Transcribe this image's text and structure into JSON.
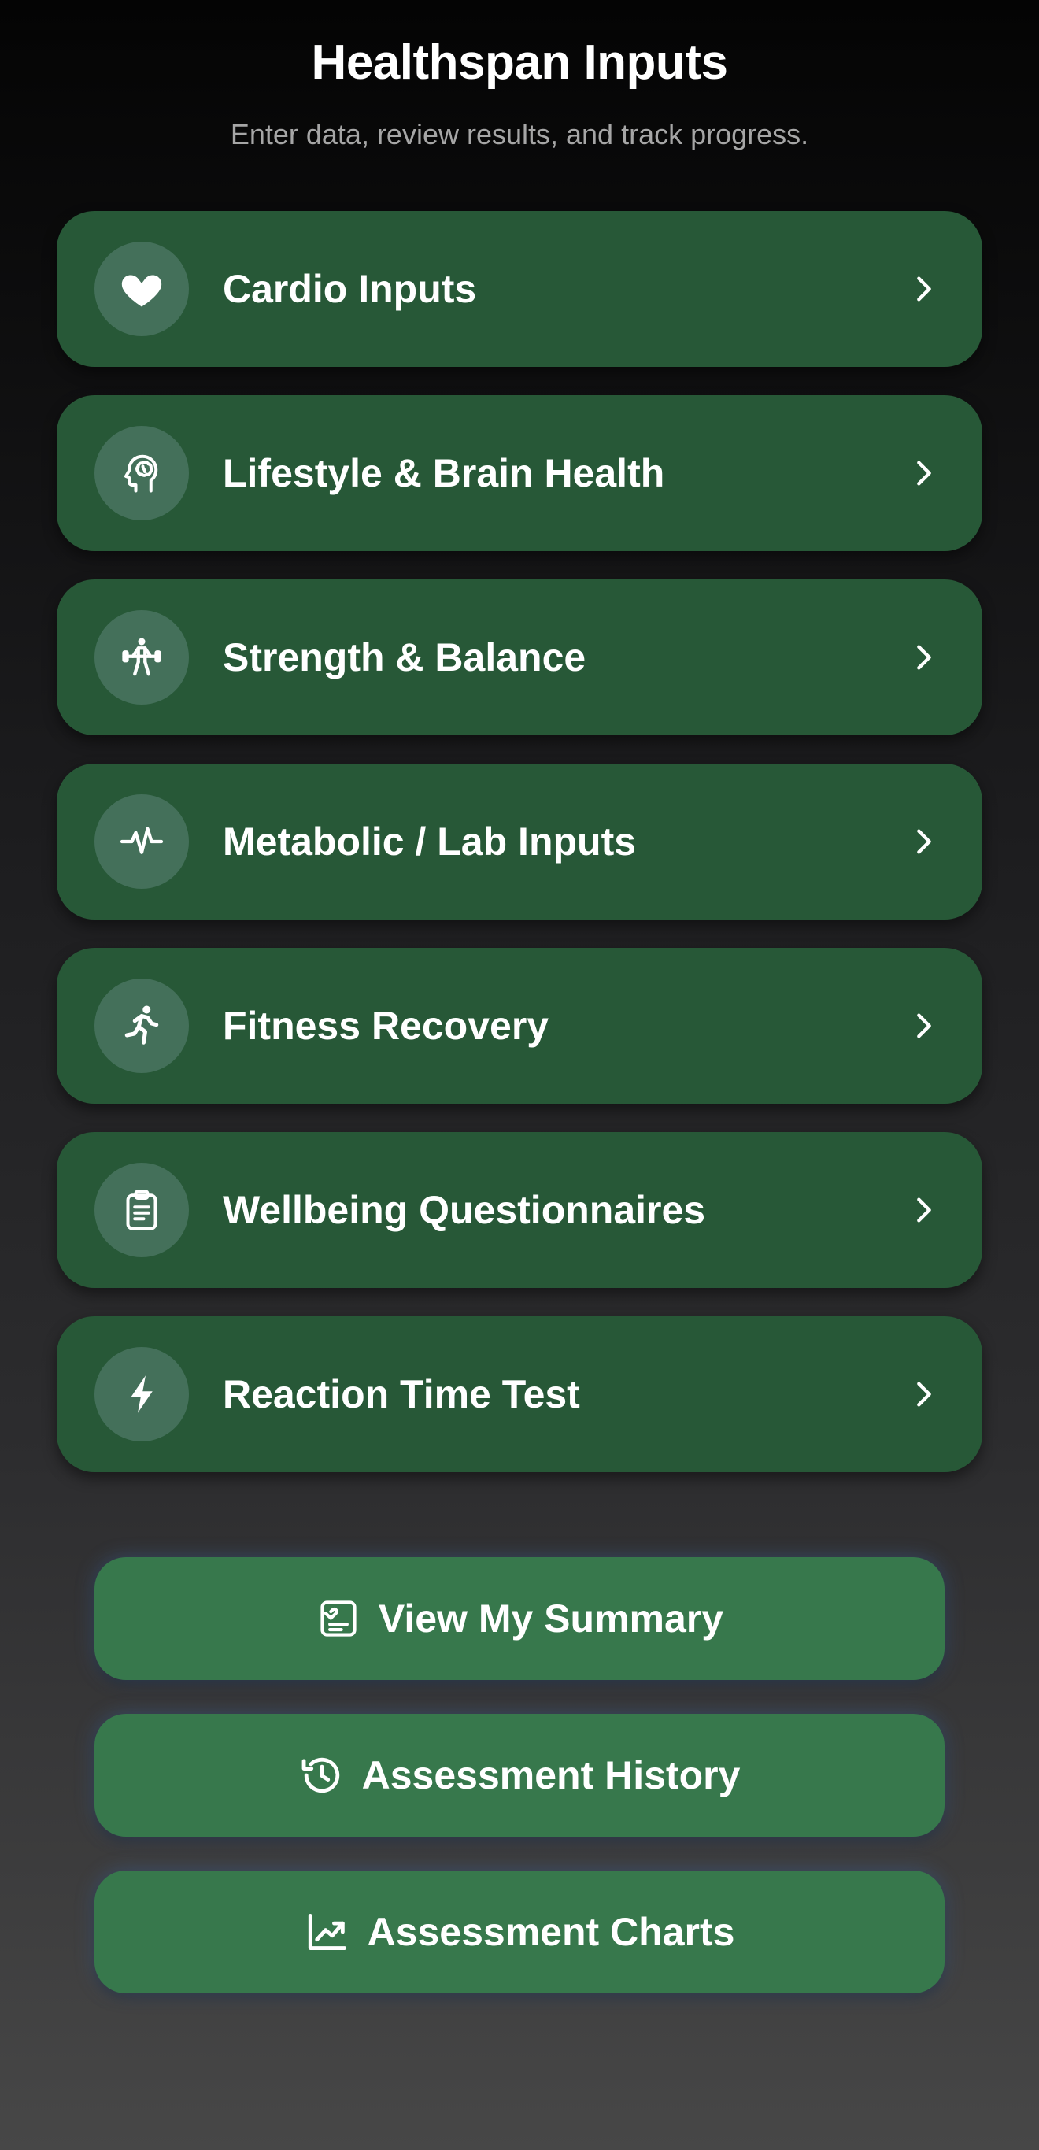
{
  "header": {
    "title": "Healthspan Inputs",
    "subtitle": "Enter data, review results, and track progress."
  },
  "categories": [
    {
      "label": "Cardio Inputs",
      "icon": "heart-icon"
    },
    {
      "label": "Lifestyle & Brain Health",
      "icon": "brain-head-icon"
    },
    {
      "label": "Strength & Balance",
      "icon": "weightlifter-icon"
    },
    {
      "label": "Metabolic / Lab Inputs",
      "icon": "pulse-icon"
    },
    {
      "label": "Fitness Recovery",
      "icon": "runner-icon"
    },
    {
      "label": "Wellbeing Questionnaires",
      "icon": "clipboard-icon"
    },
    {
      "label": "Reaction Time Test",
      "icon": "lightning-icon"
    }
  ],
  "actions": [
    {
      "label": "View My Summary",
      "icon": "summary-card-icon"
    },
    {
      "label": "Assessment History",
      "icon": "history-icon"
    },
    {
      "label": "Assessment Charts",
      "icon": "chart-trend-icon"
    }
  ],
  "colors": {
    "card_background": "#275837",
    "icon_circle": "#44705a",
    "action_button": "#37784c",
    "subtitle_text": "#a6a6a6"
  }
}
